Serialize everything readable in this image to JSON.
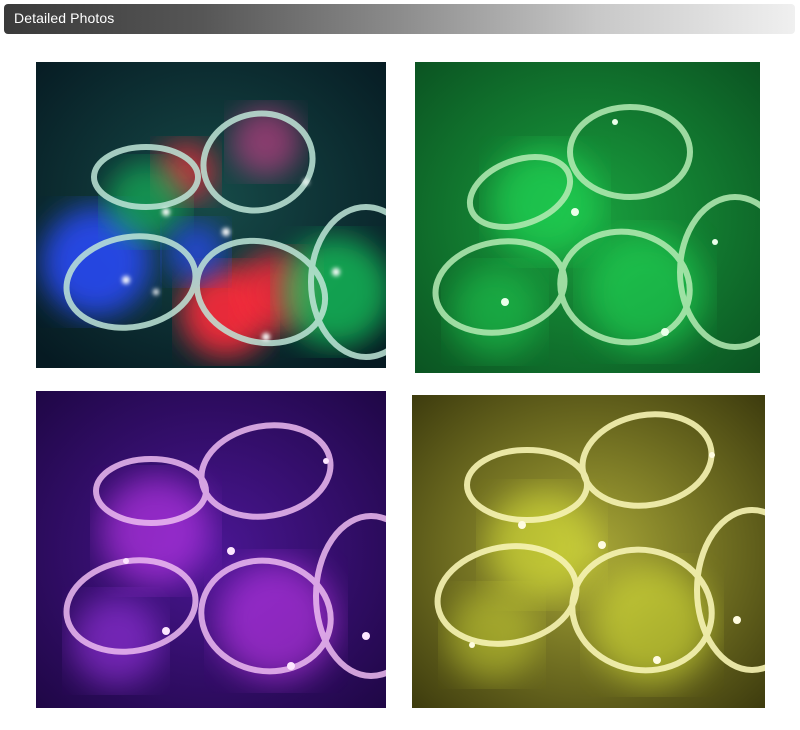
{
  "header": {
    "title": "Detailed Photos"
  },
  "photos": [
    {
      "name": "rgb-multicolor",
      "background": "#0d2e33",
      "strip_color": "#9fd9c0",
      "glows": [
        "#2b4cff",
        "#19d35e",
        "#ff2a3a",
        "#ff3fa0"
      ]
    },
    {
      "name": "green",
      "background": "#0c6a2a",
      "strip_color": "#a9e7a8",
      "glows": [
        "#22e35a"
      ]
    },
    {
      "name": "purple",
      "background": "#2a0a5a",
      "strip_color": "#e8b6ee",
      "glows": [
        "#d43cff"
      ]
    },
    {
      "name": "yellow",
      "background": "#5d5a16",
      "strip_color": "#f4f2a0",
      "glows": [
        "#e6f23a"
      ]
    }
  ]
}
